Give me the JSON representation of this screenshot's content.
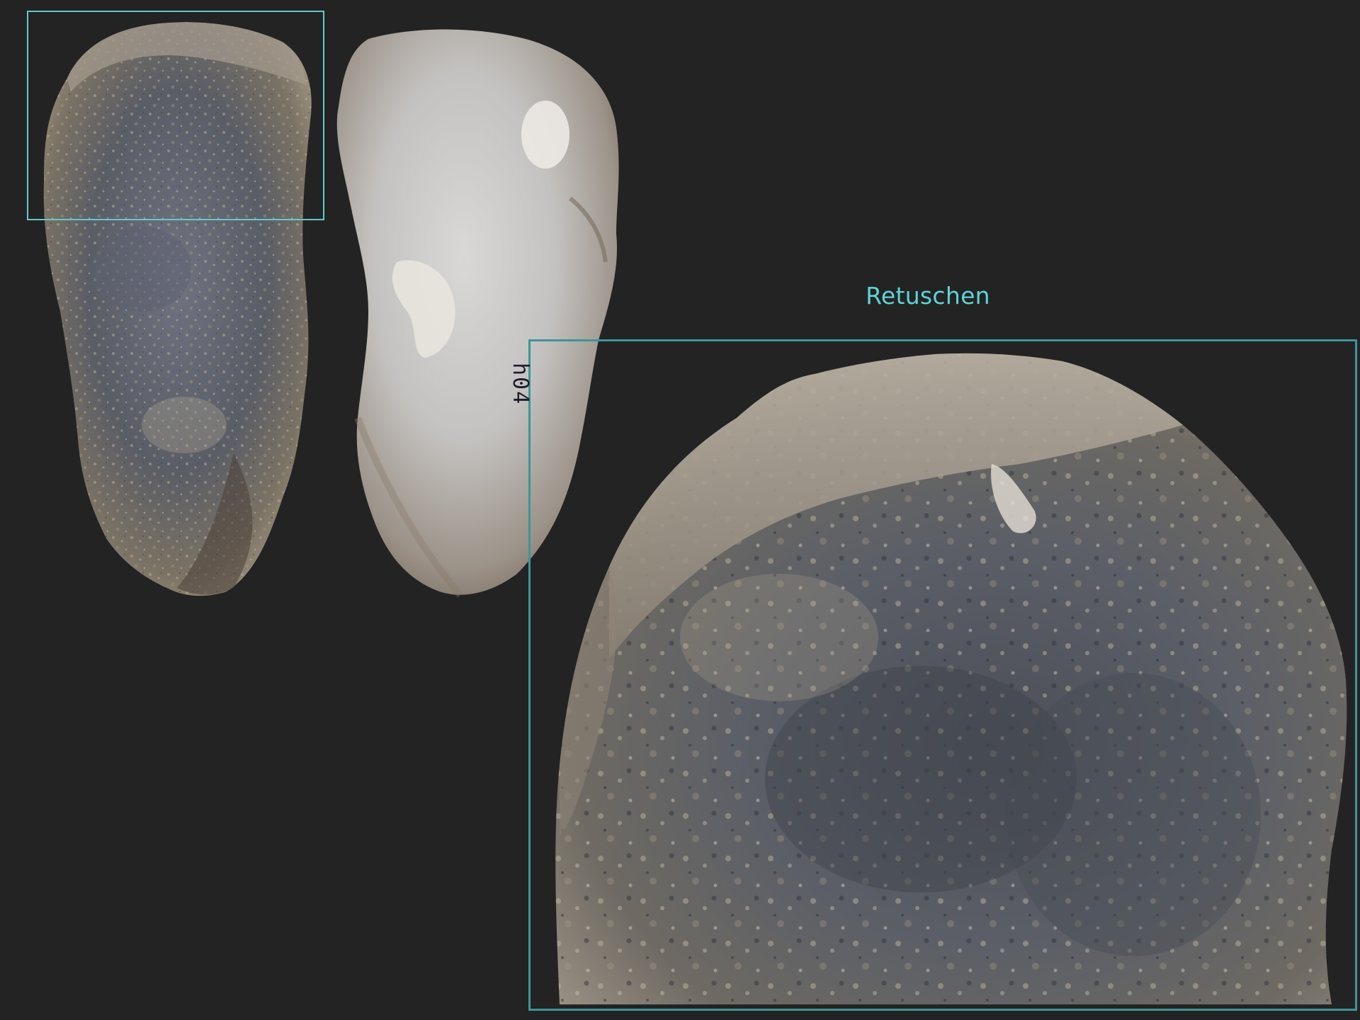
{
  "figure": {
    "caption": "Retuschen",
    "specimen_number": "h04",
    "colors": {
      "background": "#232323",
      "frame_small": "#63c9cb",
      "frame_large": "#3d9598",
      "caption": "#5fd3d6"
    },
    "views": [
      "dorsal-view",
      "ventral-view",
      "detail-zoom"
    ]
  }
}
